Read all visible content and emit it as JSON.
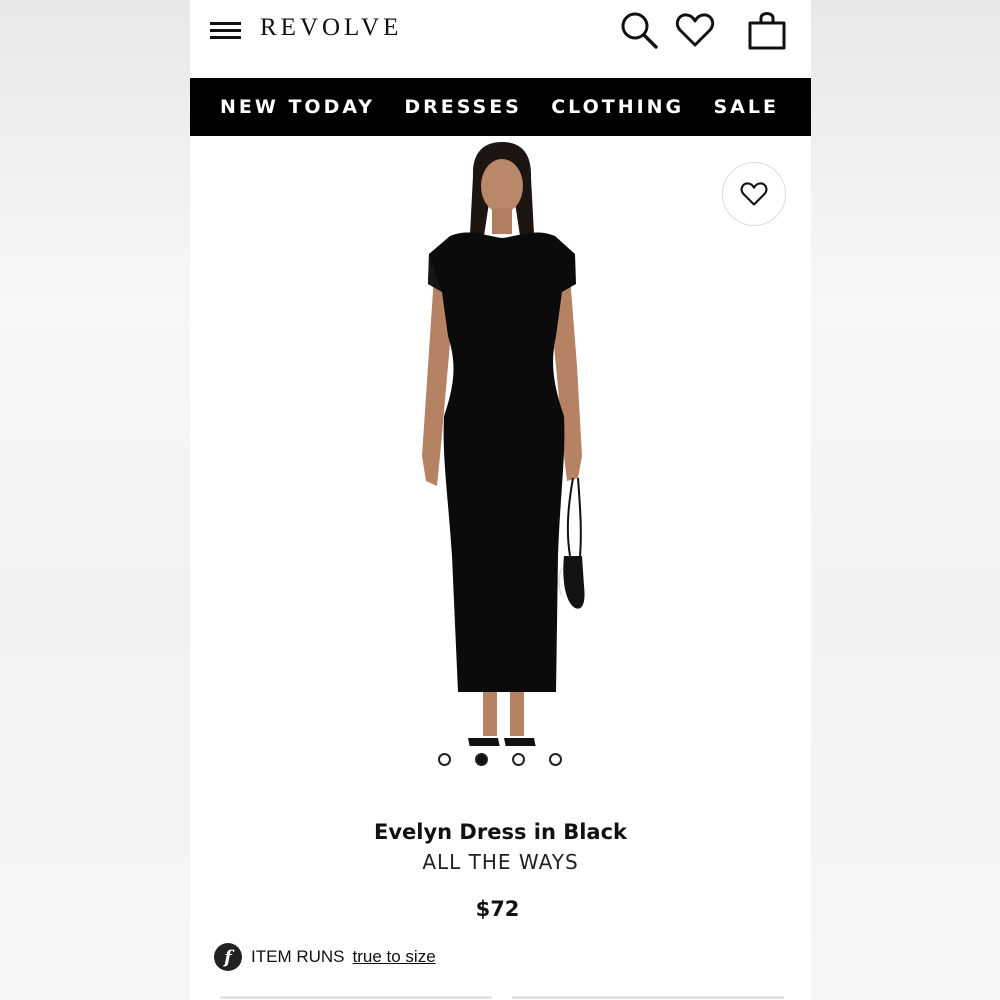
{
  "header": {
    "logo": "REVOLVE",
    "menu_icon": "hamburger-menu-icon",
    "icons": [
      "search-icon",
      "heart-icon",
      "shopping-bag-icon"
    ]
  },
  "nav": {
    "items": [
      {
        "label": "NEW TODAY"
      },
      {
        "label": "DRESSES"
      },
      {
        "label": "CLOTHING"
      },
      {
        "label": "SALE"
      }
    ]
  },
  "gallery": {
    "wishlist_icon": "heart-outline-icon",
    "image_count": 4,
    "active_index": 1
  },
  "product": {
    "name": "Evelyn Dress in Black",
    "brand": "ALL THE WAYS",
    "price": "$72"
  },
  "fit": {
    "badge_letter": "f",
    "label": "ITEM RUNS",
    "link": "true to size"
  },
  "colors": {
    "nav_bg": "#000000",
    "text": "#111111",
    "page_bg": "#ffffff"
  }
}
